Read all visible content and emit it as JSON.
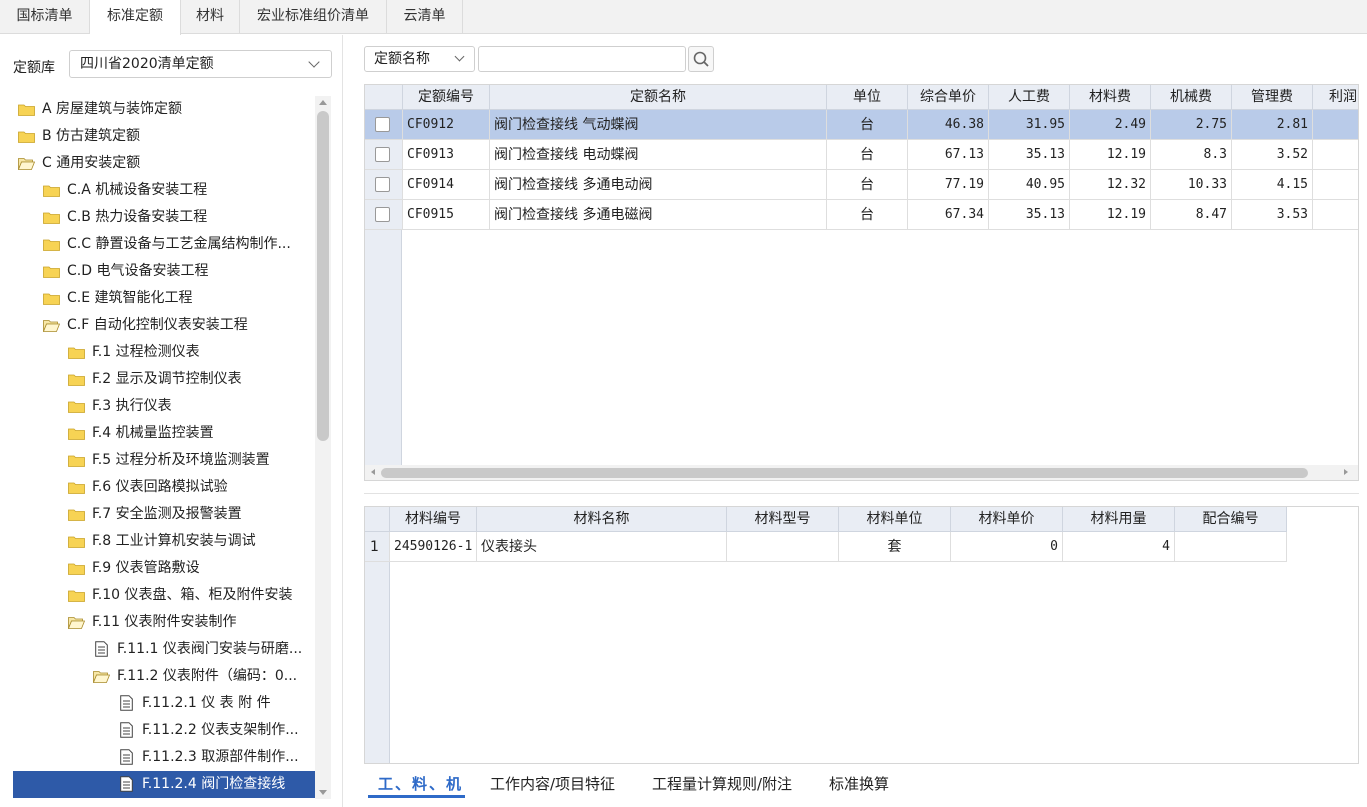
{
  "top_tabs": [
    {
      "label": "国标清单"
    },
    {
      "label": "标准定额",
      "active": true
    },
    {
      "label": "材料"
    },
    {
      "label": "宏业标准组价清单"
    },
    {
      "label": "云清单"
    }
  ],
  "library": {
    "label": "定额库",
    "value": "四川省2020清单定额"
  },
  "tree": [
    {
      "label": "A 房屋建筑与装饰定额",
      "icon": "folder-closed",
      "level": 0
    },
    {
      "label": "B 仿古建筑定额",
      "icon": "folder-closed",
      "level": 0
    },
    {
      "label": "C 通用安装定额",
      "icon": "folder-open",
      "level": 0
    },
    {
      "label": "C.A 机械设备安装工程",
      "icon": "folder-closed",
      "level": 1
    },
    {
      "label": "C.B 热力设备安装工程",
      "icon": "folder-closed",
      "level": 1
    },
    {
      "label": "C.C 静置设备与工艺金属结构制作...",
      "icon": "folder-closed",
      "level": 1
    },
    {
      "label": "C.D 电气设备安装工程",
      "icon": "folder-closed",
      "level": 1
    },
    {
      "label": "C.E 建筑智能化工程",
      "icon": "folder-closed",
      "level": 1
    },
    {
      "label": "C.F 自动化控制仪表安装工程",
      "icon": "folder-open",
      "level": 1
    },
    {
      "label": "F.1 过程检测仪表",
      "icon": "folder-closed",
      "level": 2
    },
    {
      "label": "F.2 显示及调节控制仪表",
      "icon": "folder-closed",
      "level": 2
    },
    {
      "label": "F.3 执行仪表",
      "icon": "folder-closed",
      "level": 2
    },
    {
      "label": "F.4 机械量监控装置",
      "icon": "folder-closed",
      "level": 2
    },
    {
      "label": "F.5 过程分析及环境监测装置",
      "icon": "folder-closed",
      "level": 2
    },
    {
      "label": "F.6 仪表回路模拟试验",
      "icon": "folder-closed",
      "level": 2
    },
    {
      "label": "F.7 安全监测及报警装置",
      "icon": "folder-closed",
      "level": 2
    },
    {
      "label": "F.8 工业计算机安装与调试",
      "icon": "folder-closed",
      "level": 2
    },
    {
      "label": "F.9 仪表管路敷设",
      "icon": "folder-closed",
      "level": 2
    },
    {
      "label": "F.10 仪表盘、箱、柜及附件安装",
      "icon": "folder-closed",
      "level": 2
    },
    {
      "label": "F.11 仪表附件安装制作",
      "icon": "folder-open",
      "level": 2
    },
    {
      "label": "F.11.1 仪表阀门安装与研磨...",
      "icon": "document",
      "level": 3
    },
    {
      "label": "F.11.2 仪表附件（编码：0...",
      "icon": "folder-open",
      "level": 3
    },
    {
      "label": "F.11.2.1 仪 表 附 件",
      "icon": "document",
      "level": 4
    },
    {
      "label": "F.11.2.2 仪表支架制作...",
      "icon": "document",
      "level": 4
    },
    {
      "label": "F.11.2.3 取源部件制作...",
      "icon": "document",
      "level": 4
    },
    {
      "label": "F.11.2.4 阀门检查接线",
      "icon": "document",
      "level": 4,
      "selected": true
    }
  ],
  "search": {
    "field": "定额名称",
    "query": "",
    "icon": "magnifier-icon"
  },
  "quota_grid": {
    "headers": [
      "定额编号",
      "定额名称",
      "单位",
      "综合单价",
      "人工费",
      "材料费",
      "机械费",
      "管理费",
      "利润"
    ],
    "rows": [
      {
        "code": "CF0912",
        "name": "阀门检查接线 气动蝶阀",
        "unit": "台",
        "price": "46.38",
        "labor": "31.95",
        "material": "2.49",
        "machine": "2.75",
        "mgmt": "2.81",
        "profit": "",
        "selected": true
      },
      {
        "code": "CF0913",
        "name": "阀门检查接线 电动蝶阀",
        "unit": "台",
        "price": "67.13",
        "labor": "35.13",
        "material": "12.19",
        "machine": "8.3",
        "mgmt": "3.52",
        "profit": ""
      },
      {
        "code": "CF0914",
        "name": "阀门检查接线 多通电动阀",
        "unit": "台",
        "price": "77.19",
        "labor": "40.95",
        "material": "12.32",
        "machine": "10.33",
        "mgmt": "4.15",
        "profit": ""
      },
      {
        "code": "CF0915",
        "name": "阀门检查接线 多通电磁阀",
        "unit": "台",
        "price": "67.34",
        "labor": "35.13",
        "material": "12.19",
        "machine": "8.47",
        "mgmt": "3.53",
        "profit": ""
      }
    ]
  },
  "material_grid": {
    "headers": [
      "材料编号",
      "材料名称",
      "材料型号",
      "材料单位",
      "材料单价",
      "材料用量",
      "配合编号"
    ],
    "rows": [
      {
        "index": "1",
        "code": "24590126-1",
        "name": "仪表接头",
        "model": "",
        "unit": "套",
        "price": "0",
        "qty": "4",
        "mix": ""
      }
    ]
  },
  "bottom_tabs": [
    {
      "label": "工、料、机",
      "active": true
    },
    {
      "label": "工作内容/项目特征"
    },
    {
      "label": "工程量计算规则/附注"
    },
    {
      "label": "标准换算"
    }
  ],
  "colors": {
    "accent": "#2e6ac8",
    "selected_tree": "#2e5aa8",
    "selected_row": "#b9cbe9",
    "folder": "#f7d354"
  }
}
